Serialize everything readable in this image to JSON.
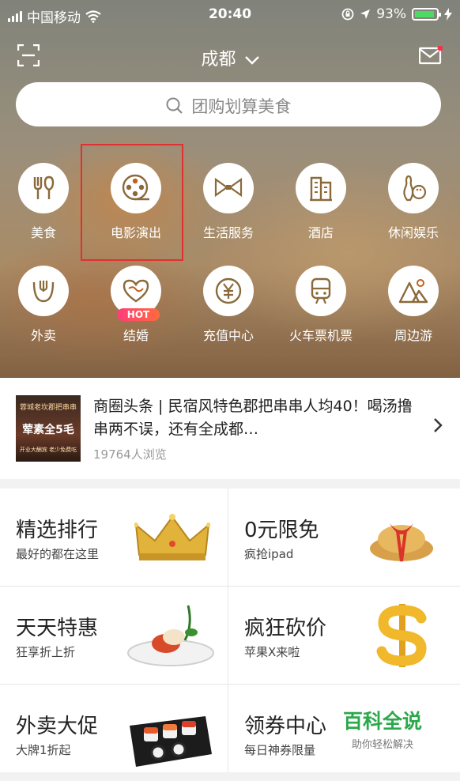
{
  "status_bar": {
    "carrier": "中国移动",
    "time": "20:40",
    "battery": "93%"
  },
  "header": {
    "city": "成都"
  },
  "search": {
    "placeholder": "团购划算美食"
  },
  "categories": [
    {
      "label": "美食",
      "icon": "utensils-icon"
    },
    {
      "label": "电影演出",
      "icon": "film-reel-icon"
    },
    {
      "label": "生活服务",
      "icon": "bow-tie-icon"
    },
    {
      "label": "酒店",
      "icon": "hotel-building-icon"
    },
    {
      "label": "休闲娱乐",
      "icon": "bowling-icon"
    },
    {
      "label": "外卖",
      "icon": "fork-bowl-icon"
    },
    {
      "label": "结婚",
      "icon": "heart-icon",
      "badge": "HOT"
    },
    {
      "label": "充值中心",
      "icon": "yen-coin-icon"
    },
    {
      "label": "火车票机票",
      "icon": "train-icon"
    },
    {
      "label": "周边游",
      "icon": "mountain-icon"
    }
  ],
  "headline": {
    "title": "商圈头条 | 民宿风特色郡把串串人均40！喝汤撸串两不误，还有全成都…",
    "views": "19764人浏览",
    "thumb_top": "蓉城老坎郡把串串",
    "thumb_main": "荤素全5毛",
    "thumb_bottom": "开业大酬宾 老少免费吃"
  },
  "promos": [
    {
      "title": "精选排行",
      "subtitle": "最好的都在这里",
      "icon": "crown-icon"
    },
    {
      "title": "0元限免",
      "subtitle": "疯抢ipad",
      "icon": "gift-icon"
    },
    {
      "title": "天天特惠",
      "subtitle": "狂享折上折",
      "icon": "dessert-plate-icon"
    },
    {
      "title": "疯狂砍价",
      "subtitle": "苹果X来啦",
      "icon": "dollar-icon"
    },
    {
      "title": "外卖大促",
      "subtitle": "大牌1折起",
      "icon": "sushi-icon"
    },
    {
      "title": "领券中心",
      "subtitle": "每日神券限量",
      "icon": "coupon-icon"
    }
  ],
  "watermark": {
    "title": "百科全说",
    "subtitle": "助你轻松解决"
  }
}
